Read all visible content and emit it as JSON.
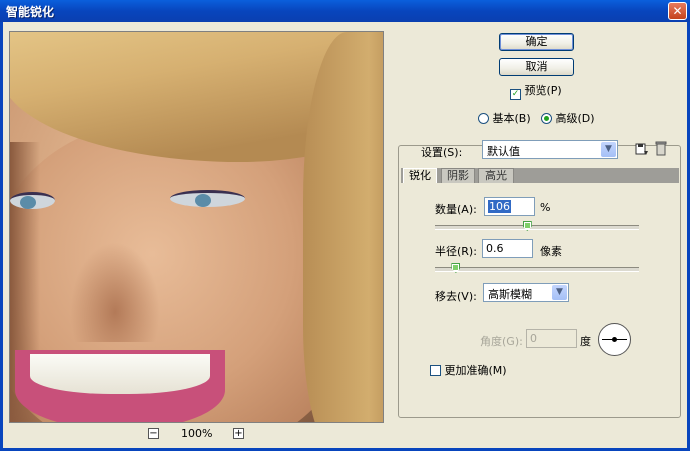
{
  "window": {
    "title": "智能锐化",
    "close_glyph": "✕"
  },
  "buttons": {
    "ok": "确定",
    "cancel": "取消"
  },
  "preview_toggle": {
    "label": "预览(P)",
    "checked": true
  },
  "mode": {
    "basic": "基本(B)",
    "advanced": "高级(D)",
    "selected": "advanced"
  },
  "settings": {
    "label": "设置(S):",
    "value": "默认值",
    "save_icon": "save-settings-icon",
    "delete_icon": "trash-icon"
  },
  "tabs": [
    {
      "label": "锐化",
      "active": true
    },
    {
      "label": "阴影",
      "active": false
    },
    {
      "label": "高光",
      "active": false
    }
  ],
  "amount": {
    "label": "数量(A):",
    "value": "106",
    "unit": "%",
    "slider_fraction": 0.45
  },
  "radius": {
    "label": "半径(R):",
    "value": "0.6",
    "unit": "像素",
    "slider_fraction": 0.1
  },
  "remove": {
    "label": "移去(V):",
    "value": "高斯模糊"
  },
  "angle": {
    "label": "角度(G):",
    "value": "0",
    "unit": "度"
  },
  "accurate": {
    "label": "更加准确(M)",
    "checked": false
  },
  "zoom": {
    "value": "100%",
    "minus": "−",
    "plus": "+"
  },
  "colors": {
    "titlebar": "#0845bd",
    "dialog_bg": "#ece9d8",
    "check": "#21a121"
  }
}
